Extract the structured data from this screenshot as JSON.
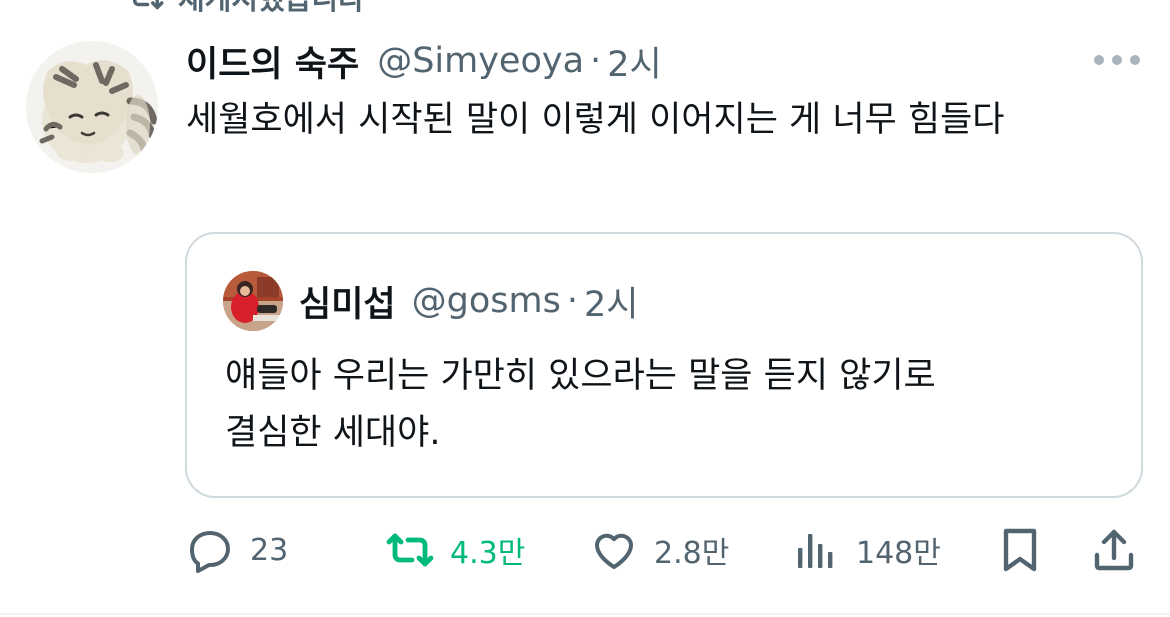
{
  "repost_banner": {
    "text": "재게시했습니다",
    "icon": "retweet-icon"
  },
  "tweet": {
    "display_name": "이드의 숙주",
    "handle": "@Simyeoya",
    "separator": "·",
    "time": "2시",
    "text": "세월호에서 시작된 말이 이렇게 이어지는 게 너무 힘들다"
  },
  "quote": {
    "display_name": "심미섭",
    "handle": "@gosms",
    "separator": "·",
    "time": "2시",
    "text_line1": "얘들아 우리는 가만히 있으라는 말을 듣지 않기로",
    "text_line2": "결심한 세대야."
  },
  "actions": {
    "replies": "23",
    "reposts": "4.3만",
    "likes": "2.8만",
    "views": "148만"
  },
  "colors": {
    "text": "#0f1419",
    "secondary": "#536471",
    "retweet": "#00ba7c",
    "border": "#cfd9de"
  }
}
